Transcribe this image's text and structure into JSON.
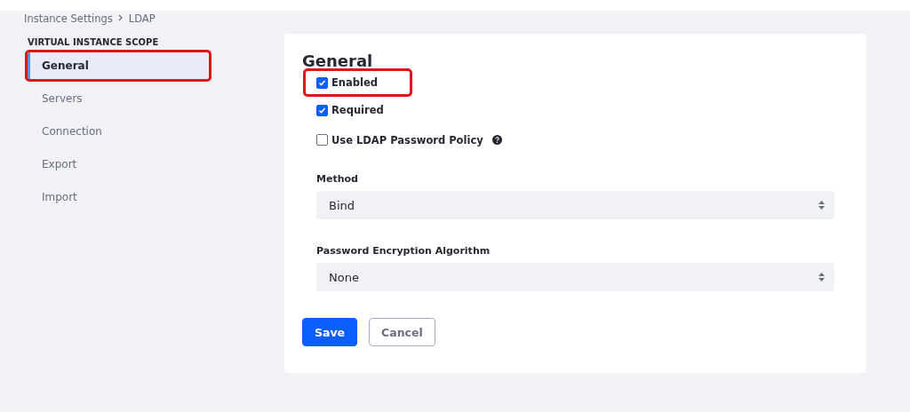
{
  "breadcrumb": [
    {
      "label": "Instance Settings"
    },
    {
      "label": "LDAP"
    }
  ],
  "sidebar": {
    "heading": "VIRTUAL INSTANCE SCOPE",
    "items": [
      {
        "label": "General",
        "selected": true,
        "highlighted": true
      },
      {
        "label": "Servers",
        "selected": false,
        "highlighted": false
      },
      {
        "label": "Connection",
        "selected": false,
        "highlighted": false
      },
      {
        "label": "Export",
        "selected": false,
        "highlighted": false
      },
      {
        "label": "Import",
        "selected": false,
        "highlighted": false
      }
    ]
  },
  "form": {
    "title": "General",
    "checkboxes": [
      {
        "label": "Enabled",
        "checked": true,
        "highlighted": true,
        "help": false
      },
      {
        "label": "Required",
        "checked": true,
        "highlighted": false,
        "help": false
      },
      {
        "label": "Use LDAP Password Policy",
        "checked": false,
        "highlighted": false,
        "help": true
      }
    ],
    "selects": [
      {
        "label": "Method",
        "value": "Bind"
      },
      {
        "label": "Password Encryption Algorithm",
        "value": "None"
      }
    ],
    "buttons": [
      {
        "label": "Save",
        "kind": "primary"
      },
      {
        "label": "Cancel",
        "kind": "secondary"
      }
    ]
  }
}
